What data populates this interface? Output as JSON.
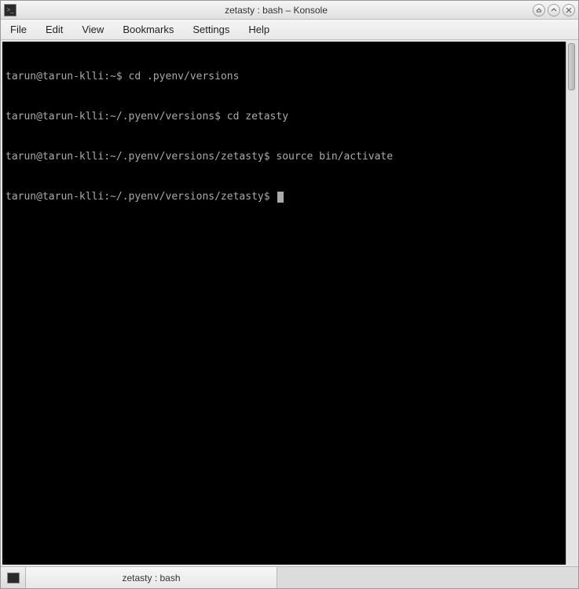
{
  "window": {
    "title": "zetasty : bash – Konsole"
  },
  "menubar": {
    "items": [
      "File",
      "Edit",
      "View",
      "Bookmarks",
      "Settings",
      "Help"
    ]
  },
  "terminal": {
    "lines": [
      {
        "prompt": "tarun@tarun-klli:~$ ",
        "command": "cd .pyenv/versions"
      },
      {
        "prompt": "tarun@tarun-klli:~/.pyenv/versions$ ",
        "command": "cd zetasty"
      },
      {
        "prompt": "tarun@tarun-klli:~/.pyenv/versions/zetasty$ ",
        "command": "source bin/activate"
      },
      {
        "prompt": "tarun@tarun-klli:~/.pyenv/versions/zetasty$ ",
        "command": ""
      }
    ]
  },
  "tabs": {
    "active": "zetasty : bash"
  }
}
